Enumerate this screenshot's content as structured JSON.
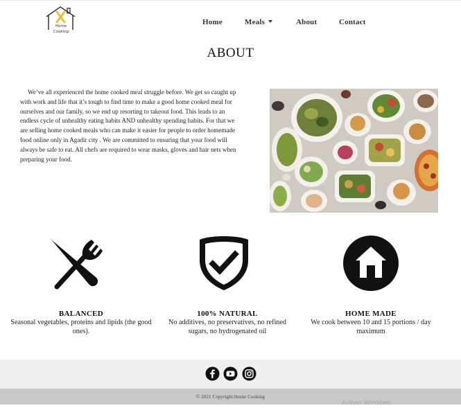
{
  "header": {
    "logo": {
      "text_line1": "Home",
      "text_line2": "Cooking",
      "accent_color": "#e2c230"
    },
    "nav": [
      {
        "label": "Home"
      },
      {
        "label": "Meals",
        "has_dropdown": true
      },
      {
        "label": "About"
      },
      {
        "label": "Contact"
      }
    ]
  },
  "main": {
    "title": "ABOUT",
    "paragraph": "We’ve all experienced the home cooked meal struggle before. We get so caught up with work and life that it’s tough to find time to make a good home cooked meal for ourselves and our family, so we end up resorting to takeout food. This leads to an endless cycle of unhealthy eating habits AND unhealthy spending habits. For that we are selling home cooked meals who can make it easier for people to order homemade food online only in Agadir city . We are committed to ensuring that your food will always be safe to eat. All chefs are required to wear masks, gloves and hair nets when preparing your food.",
    "image_icon": "food-spread-photo"
  },
  "features": [
    {
      "icon": "cutlery-icon",
      "title": "BALANCED",
      "description": "Seasonal vegetables, proteins and lipids (the good ones)."
    },
    {
      "icon": "shield-check-icon",
      "title": "100% NATURAL",
      "description": "No additives, no preservatives, no refined sugars, no hydrogenated oil"
    },
    {
      "icon": "home-icon",
      "title": "HOME MADE",
      "description": "We cook between 10 and 15 portions / day maximum"
    }
  ],
  "footer": {
    "social": [
      "facebook-icon",
      "youtube-icon",
      "instagram-icon"
    ],
    "copyright": "© 2021 Copyright:Home Cooking",
    "watermark": "Activer Windows"
  },
  "colors": {
    "footer_top": "#efefef",
    "footer_bottom": "#c9c9c9",
    "icon": "#111111"
  }
}
